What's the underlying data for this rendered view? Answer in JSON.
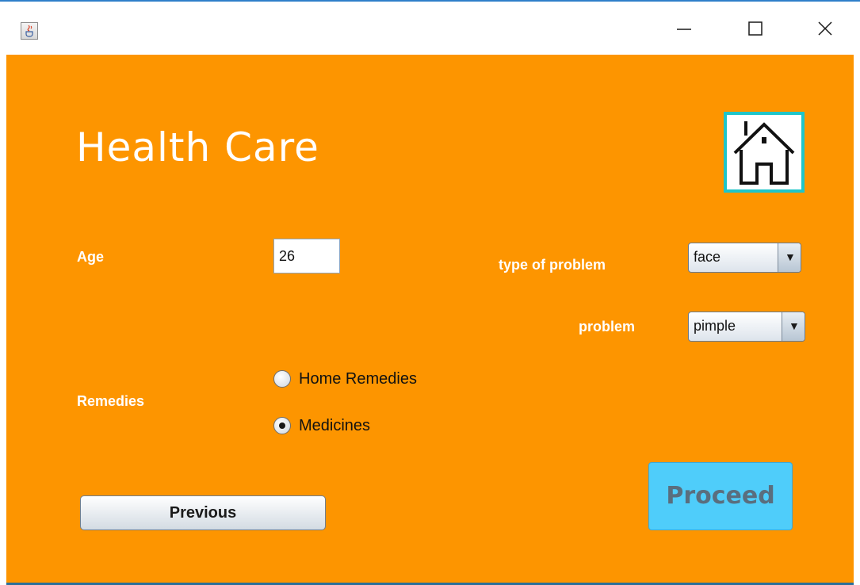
{
  "titlebar": {
    "app_icon": "java-cup-icon",
    "minimize_icon": "minimize-icon",
    "maximize_icon": "maximize-icon",
    "close_icon": "close-icon"
  },
  "app": {
    "title": "Health Care",
    "home_icon": "house-icon",
    "background_color": "#fd9500",
    "home_border_color": "#1fc5c9",
    "proceed_color": "#4fcdfa"
  },
  "form": {
    "age_label": "Age",
    "age_value": "26",
    "type_of_problem_label": "type of problem",
    "type_of_problem_value": "face",
    "problem_label": "problem",
    "problem_value": "pimple",
    "remedies_label": "Remedies",
    "remedies_options": [
      {
        "label": "Home Remedies",
        "selected": false
      },
      {
        "label": "Medicines",
        "selected": true
      }
    ]
  },
  "buttons": {
    "previous_label": "Previous",
    "proceed_label": "Proceed"
  }
}
